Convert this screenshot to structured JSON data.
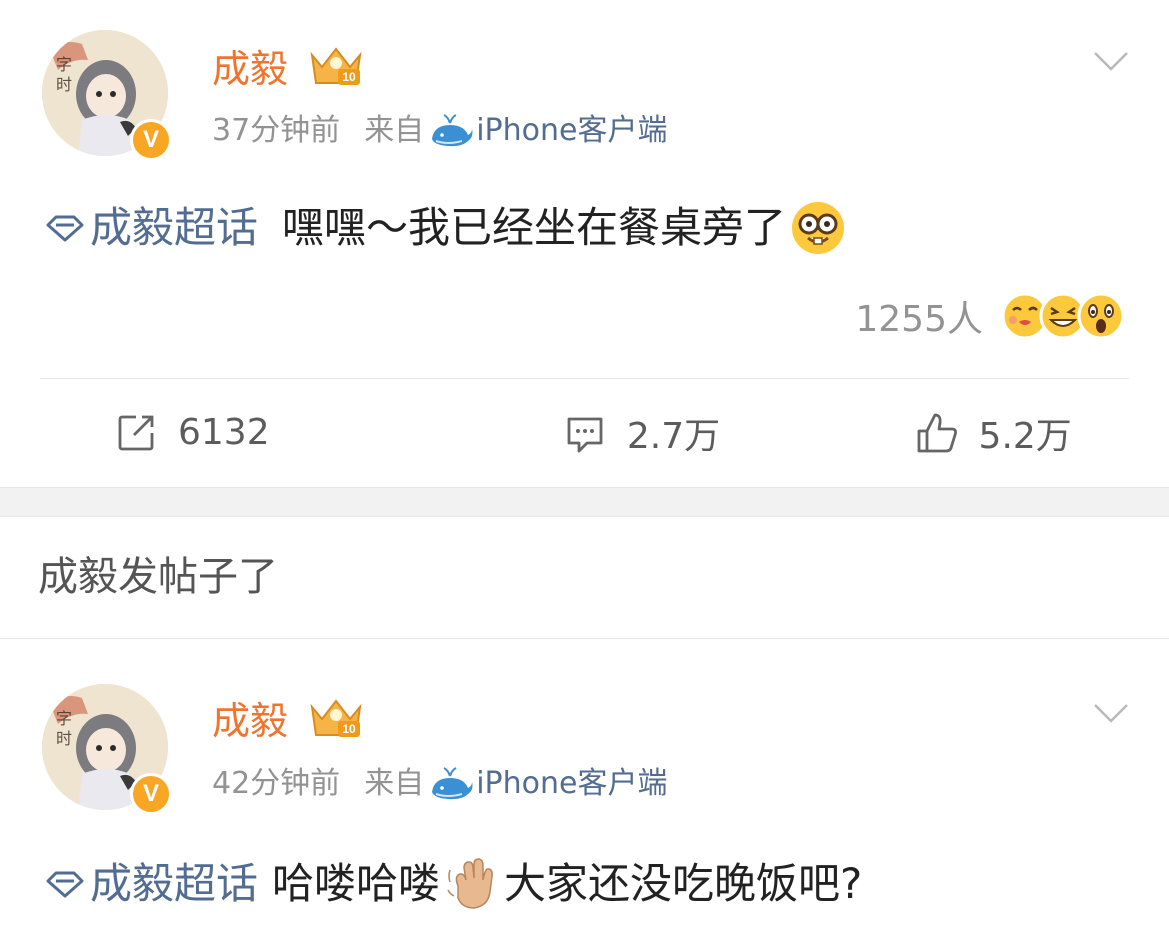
{
  "posts": [
    {
      "author": "成毅",
      "level_badge": "10",
      "verified_badge": "V",
      "time": "37分钟前",
      "from_label": "来自",
      "client": "iPhone客户端",
      "topic": "成毅超话",
      "text": "嘿嘿～我已经坐在餐桌旁了",
      "emoji": "nerd-face",
      "reaction_count": "1255人",
      "reaction_emojis": [
        "kissing-face",
        "grinning-squint-face",
        "astonished-face"
      ],
      "actions": {
        "repost": "6132",
        "comment": "2.7万",
        "like": "5.2万"
      }
    },
    {
      "author": "成毅",
      "level_badge": "10",
      "verified_badge": "V",
      "time": "42分钟前",
      "from_label": "来自",
      "client": "iPhone客户端",
      "topic": "成毅超话",
      "text_before": "哈喽哈喽",
      "emoji": "waving-hand",
      "text_after": "大家还没吃晚饭吧?"
    }
  ],
  "section_label": "成毅发帖子了",
  "colors": {
    "name": "#f0742d",
    "link": "#536d92",
    "meta": "#939393",
    "verified": "#f8a623"
  }
}
